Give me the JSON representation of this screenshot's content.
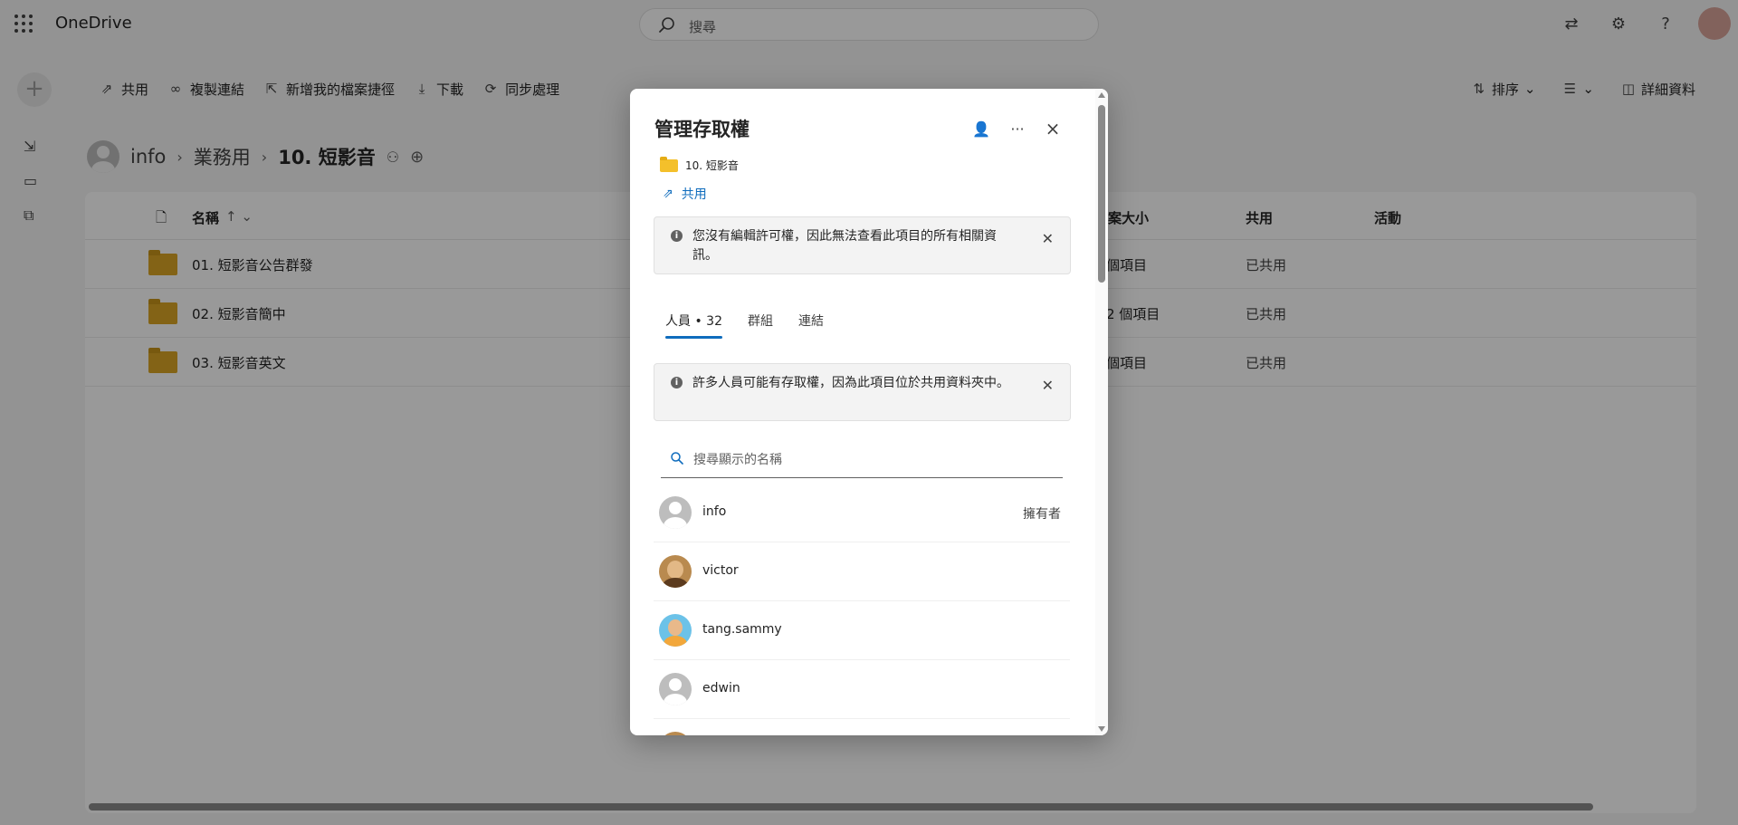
{
  "app": {
    "brand": "OneDrive",
    "search_placeholder": "搜尋"
  },
  "toolbar": {
    "share": "共用",
    "copy_link": "複製連結",
    "add_shortcut": "新增我的檔案捷徑",
    "download": "下載",
    "sync": "同步處理",
    "sort": "排序",
    "details": "詳細資料"
  },
  "breadcrumb": {
    "root": "info",
    "parent": "業務用",
    "current": "10. 短影音"
  },
  "file_list": {
    "columns": {
      "name": "名稱",
      "size": "案大小",
      "sharing": "共用",
      "activity": "活動"
    },
    "rows": [
      {
        "name": "01. 短影音公告群發",
        "size": "個項目",
        "sharing": "已共用"
      },
      {
        "name": "02. 短影音簡中",
        "size": "2 個項目",
        "sharing": "已共用"
      },
      {
        "name": "03. 短影音英文",
        "size": "個項目",
        "sharing": "已共用"
      }
    ]
  },
  "dialog": {
    "title": "管理存取權",
    "item_name": "10. 短影音",
    "share_label": "共用",
    "banner_permission": "您沒有編輯許可權，因此無法查看此項目的所有相關資訊。",
    "banner_shared_folder": "許多人員可能有存取權，因為此項目位於共用資料夾中。",
    "tabs": {
      "people": "人員 • 32",
      "groups": "群組",
      "links": "連結"
    },
    "search_placeholder": "搜尋顯示的名稱",
    "people": [
      {
        "name": "info",
        "role": "擁有者"
      },
      {
        "name": "victor",
        "role": ""
      },
      {
        "name": "tang.sammy",
        "role": ""
      },
      {
        "name": "edwin",
        "role": ""
      }
    ]
  }
}
